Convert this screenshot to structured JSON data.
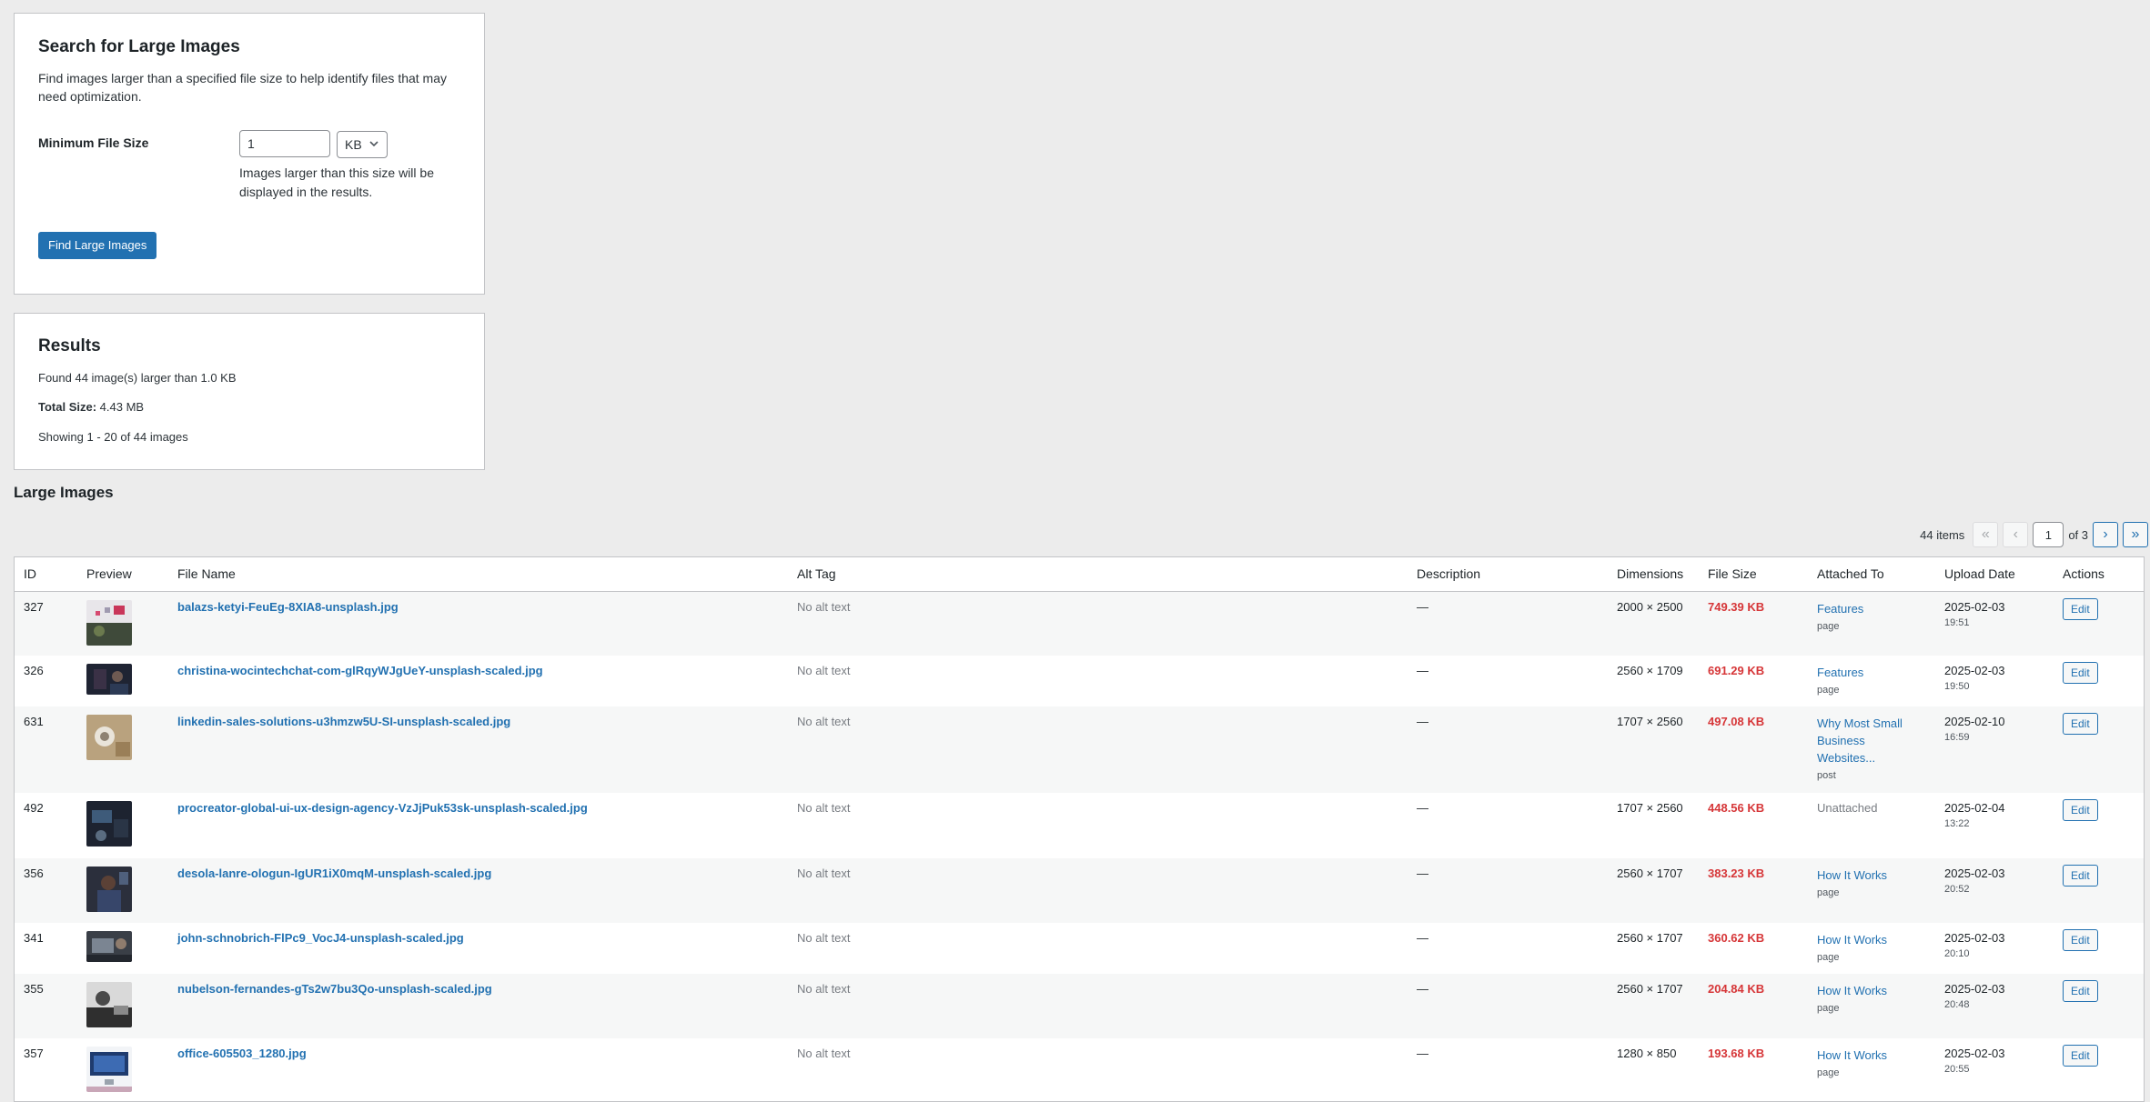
{
  "search": {
    "title": "Search for Large Images",
    "description": "Find images larger than a specified file size to help identify files that may need optimization.",
    "min_label": "Minimum File Size",
    "min_value": "1",
    "unit": "KB",
    "help": "Images larger than this size will be displayed in the results.",
    "button": "Find Large Images"
  },
  "results": {
    "title": "Results",
    "found": "Found 44 image(s) larger than 1.0 KB",
    "total_label": "Total Size:",
    "total_value": "4.43 MB",
    "showing": "Showing 1 - 20 of 44 images"
  },
  "list": {
    "title": "Large Images",
    "items_count": "44 items",
    "first": "«",
    "prev": "‹",
    "current_page": "1",
    "of_pages": "of 3",
    "next": "›",
    "last": "»",
    "columns": [
      "ID",
      "Preview",
      "File Name",
      "Alt Tag",
      "Description",
      "Dimensions",
      "File Size",
      "Attached To",
      "Upload Date",
      "Actions"
    ],
    "edit_label": "Edit",
    "rows": [
      {
        "id": "327",
        "file": "balazs-ketyi-FeuEg-8XIA8-unsplash.jpg",
        "alt": "No alt text",
        "desc": "—",
        "dims": "2000 × 2500",
        "size": "749.39 KB",
        "attached": "Features",
        "type": "page",
        "date": "2025-02-03",
        "time": "19:51"
      },
      {
        "id": "326",
        "file": "christina-wocintechchat-com-glRqyWJgUeY-unsplash-scaled.jpg",
        "alt": "No alt text",
        "desc": "—",
        "dims": "2560 × 1709",
        "size": "691.29 KB",
        "attached": "Features",
        "type": "page",
        "date": "2025-02-03",
        "time": "19:50"
      },
      {
        "id": "631",
        "file": "linkedin-sales-solutions-u3hmzw5U-SI-unsplash-scaled.jpg",
        "alt": "No alt text",
        "desc": "—",
        "dims": "1707 × 2560",
        "size": "497.08 KB",
        "attached": "Why Most Small Business Websites...",
        "type": "post",
        "date": "2025-02-10",
        "time": "16:59"
      },
      {
        "id": "492",
        "file": "procreator-global-ui-ux-design-agency-VzJjPuk53sk-unsplash-scaled.jpg",
        "alt": "No alt text",
        "desc": "—",
        "dims": "1707 × 2560",
        "size": "448.56 KB",
        "attached": "Unattached",
        "type": "",
        "date": "2025-02-04",
        "time": "13:22"
      },
      {
        "id": "356",
        "file": "desola-lanre-ologun-IgUR1iX0mqM-unsplash-scaled.jpg",
        "alt": "No alt text",
        "desc": "—",
        "dims": "2560 × 1707",
        "size": "383.23 KB",
        "attached": "How It Works",
        "type": "page",
        "date": "2025-02-03",
        "time": "20:52"
      },
      {
        "id": "341",
        "file": "john-schnobrich-FlPc9_VocJ4-unsplash-scaled.jpg",
        "alt": "No alt text",
        "desc": "—",
        "dims": "2560 × 1707",
        "size": "360.62 KB",
        "attached": "How It Works",
        "type": "page",
        "date": "2025-02-03",
        "time": "20:10"
      },
      {
        "id": "355",
        "file": "nubelson-fernandes-gTs2w7bu3Qo-unsplash-scaled.jpg",
        "alt": "No alt text",
        "desc": "—",
        "dims": "2560 × 1707",
        "size": "204.84 KB",
        "attached": "How It Works",
        "type": "page",
        "date": "2025-02-03",
        "time": "20:48"
      },
      {
        "id": "357",
        "file": "office-605503_1280.jpg",
        "alt": "No alt text",
        "desc": "—",
        "dims": "1280 × 850",
        "size": "193.68 KB",
        "attached": "How It Works",
        "type": "page",
        "date": "2025-02-03",
        "time": "20:55"
      }
    ]
  },
  "colors": {
    "primary": "#2271b1",
    "danger": "#d63638",
    "background": "#ececec"
  }
}
